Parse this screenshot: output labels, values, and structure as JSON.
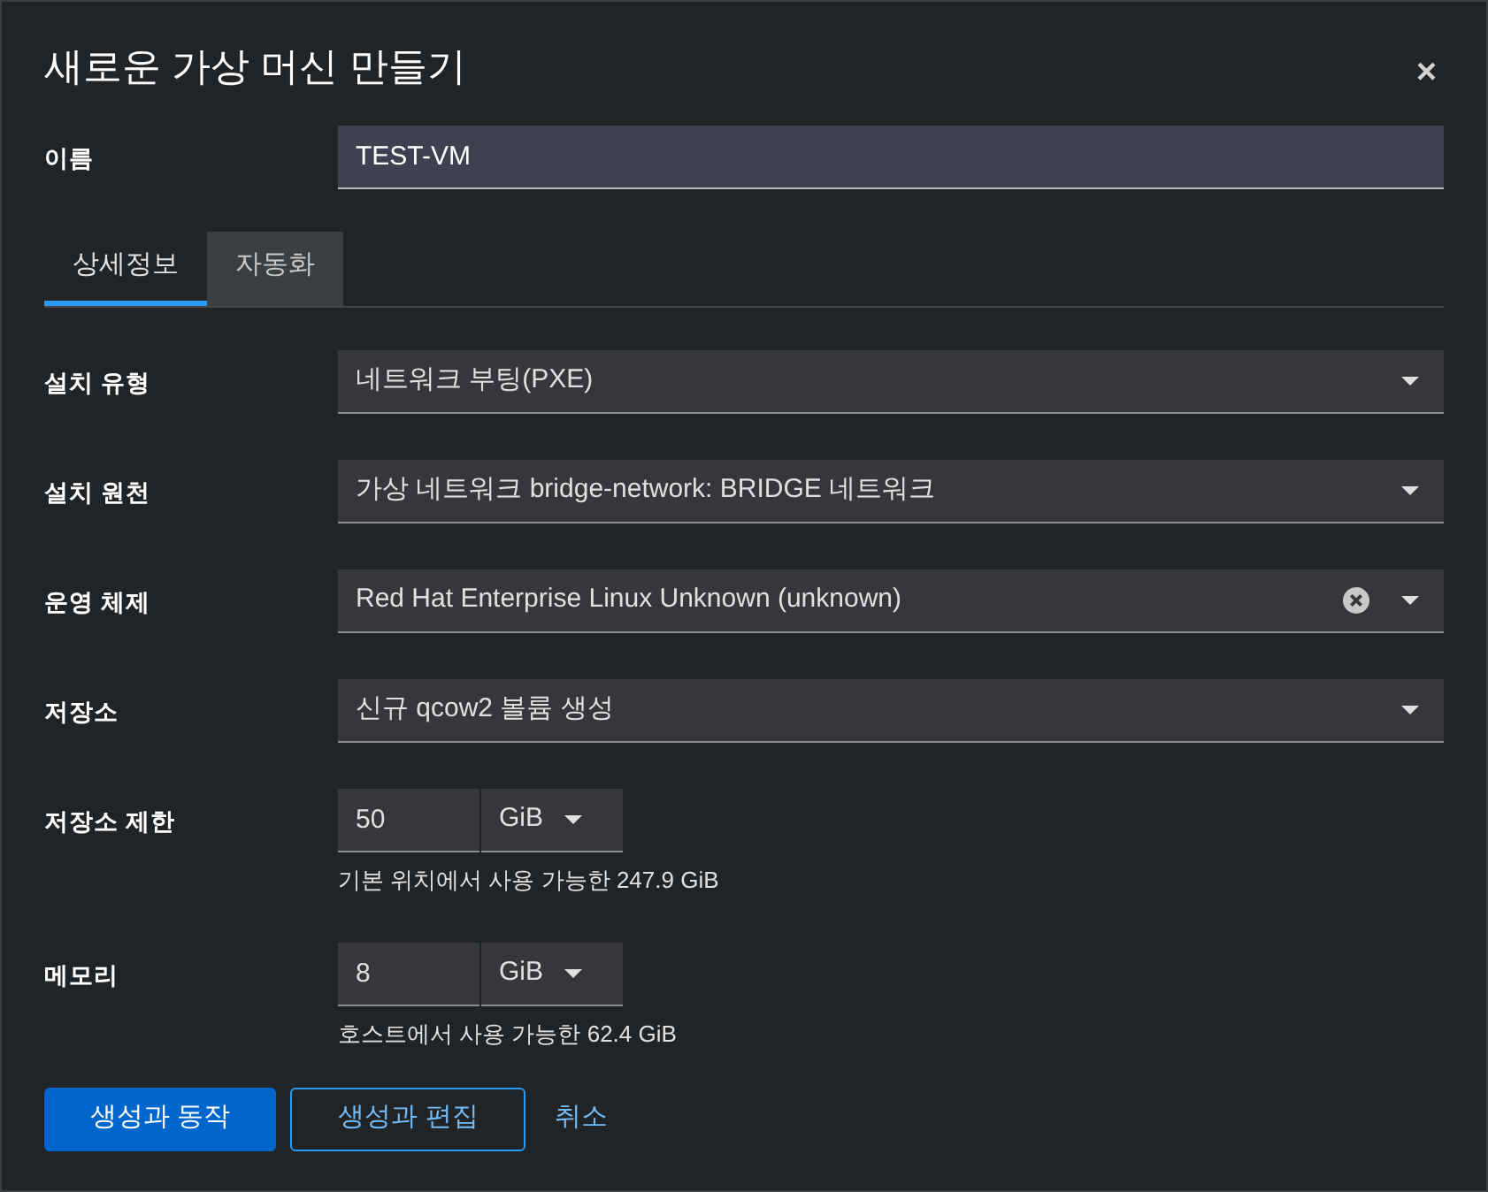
{
  "dialog": {
    "title": "새로운 가상 머신 만들기",
    "close": "×"
  },
  "name_field": {
    "label": "이름",
    "value": "TEST-VM"
  },
  "tabs": [
    {
      "label": "상세정보",
      "selected": true
    },
    {
      "label": "자동화",
      "selected": false
    }
  ],
  "fields": [
    {
      "kind": "select",
      "label": "설치 유형",
      "value": "네트워크 부팅(PXE)",
      "clearable": false
    },
    {
      "kind": "select",
      "label": "설치 원천",
      "value": "가상 네트워크 bridge-network: BRIDGE 네트워크",
      "clearable": false
    },
    {
      "kind": "select",
      "label": "운영 체제",
      "value": "Red Hat Enterprise Linux Unknown (unknown)",
      "clearable": true
    },
    {
      "kind": "select",
      "label": "저장소",
      "value": "신규 qcow2 볼륨 생성",
      "clearable": false
    },
    {
      "kind": "size",
      "label": "저장소 제한",
      "value": "50",
      "unit": "GiB",
      "helper": "기본 위치에서 사용 가능한 247.9 GiB"
    },
    {
      "kind": "size",
      "label": "메모리",
      "value": "8",
      "unit": "GiB",
      "helper": "호스트에서 사용 가능한 62.4 GiB"
    }
  ],
  "buttons": [
    {
      "kind": "primary",
      "label": "생성과 동작"
    },
    {
      "kind": "secondary",
      "label": "생성과 편집"
    },
    {
      "kind": "link",
      "label": "취소"
    }
  ]
}
